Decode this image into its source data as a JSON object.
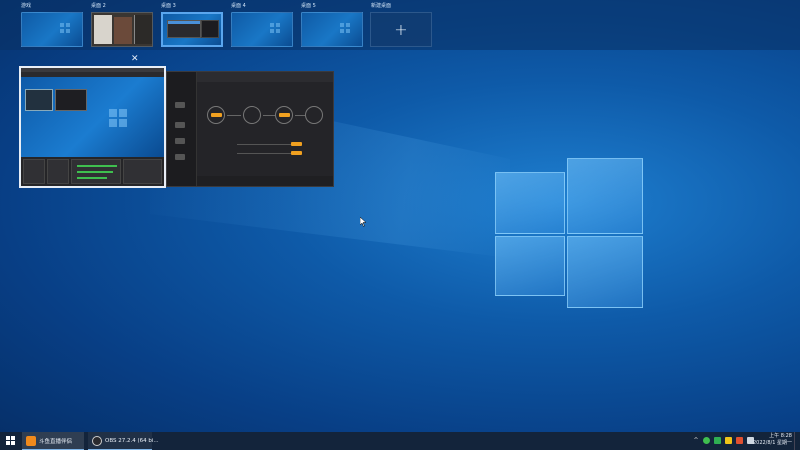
{
  "virtual_desktops": {
    "items": [
      {
        "label": "游戏"
      },
      {
        "label": "桌面 2"
      },
      {
        "label": "桌面 3",
        "active": true
      },
      {
        "label": "桌面 4"
      },
      {
        "label": "桌面 5"
      }
    ],
    "new_desktop_label": "新建桌面",
    "new_desktop_glyph": "+"
  },
  "previews": {
    "close_glyph": "✕"
  },
  "taskbar": {
    "items": [
      {
        "label": "斗鱼直播伴侣",
        "icon": "app-icon"
      },
      {
        "label": "OBS 27.2.4 (64 bi...",
        "icon": "obs-icon"
      }
    ],
    "clock_time": "上午 8:28",
    "clock_date": "2022/8/1 星期一"
  },
  "colors": {
    "accent": "#5aa6ee",
    "taskbar": "#13243b",
    "desktop": "#0e5aa8"
  }
}
